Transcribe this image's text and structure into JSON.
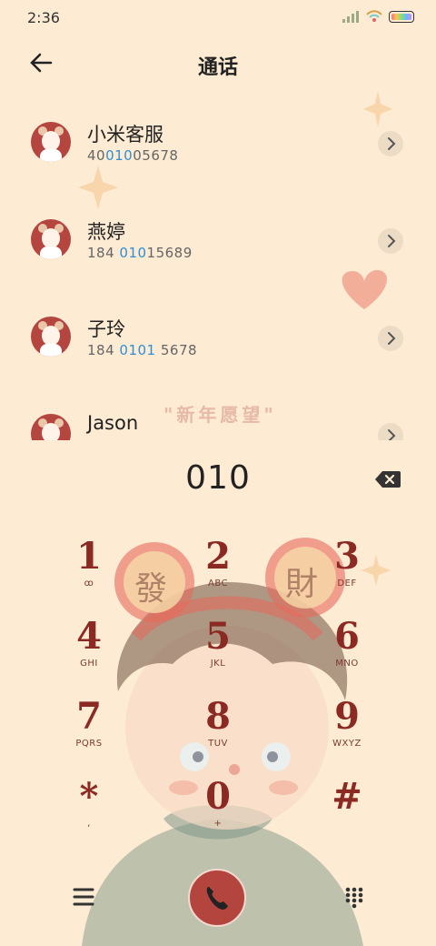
{
  "status_bar": {
    "time": "2:36"
  },
  "header": {
    "title": "通话"
  },
  "contacts": [
    {
      "name": "小米客服",
      "number_parts": [
        "40",
        "010",
        "05678"
      ]
    },
    {
      "name": "燕婷",
      "number_parts": [
        "184 ",
        "010",
        "15689"
      ]
    },
    {
      "name": "子玲",
      "number_parts": [
        "184 ",
        "0101",
        " 5678"
      ]
    },
    {
      "name": "Jason",
      "number_parts": [
        "",
        "",
        ""
      ]
    }
  ],
  "theme_text": "\"新年愿望\"",
  "decor_text": {
    "left_ear": "發",
    "right_ear": "財"
  },
  "dialer": {
    "input": "010"
  },
  "keypad": [
    {
      "digit": "1",
      "letters": "ꝏ"
    },
    {
      "digit": "2",
      "letters": "ABC"
    },
    {
      "digit": "3",
      "letters": "DEF"
    },
    {
      "digit": "4",
      "letters": "GHI"
    },
    {
      "digit": "5",
      "letters": "JKL"
    },
    {
      "digit": "6",
      "letters": "MNO"
    },
    {
      "digit": "7",
      "letters": "PQRS"
    },
    {
      "digit": "8",
      "letters": "TUV"
    },
    {
      "digit": "9",
      "letters": "WXYZ"
    },
    {
      "digit": "*",
      "letters": ","
    },
    {
      "digit": "0",
      "letters": "+"
    },
    {
      "digit": "#",
      "letters": ""
    }
  ],
  "colors": {
    "background": "#fdebd3",
    "accent": "#b4453e",
    "highlight": "#2f8fd6",
    "digit": "#8b2a22"
  },
  "icons": {
    "back": "arrow-left-icon",
    "chevron": "chevron-right-icon",
    "backspace": "backspace-icon",
    "menu": "menu-icon",
    "call": "phone-icon",
    "keypad": "dialpad-icon",
    "voicemail": "voicemail-icon"
  }
}
